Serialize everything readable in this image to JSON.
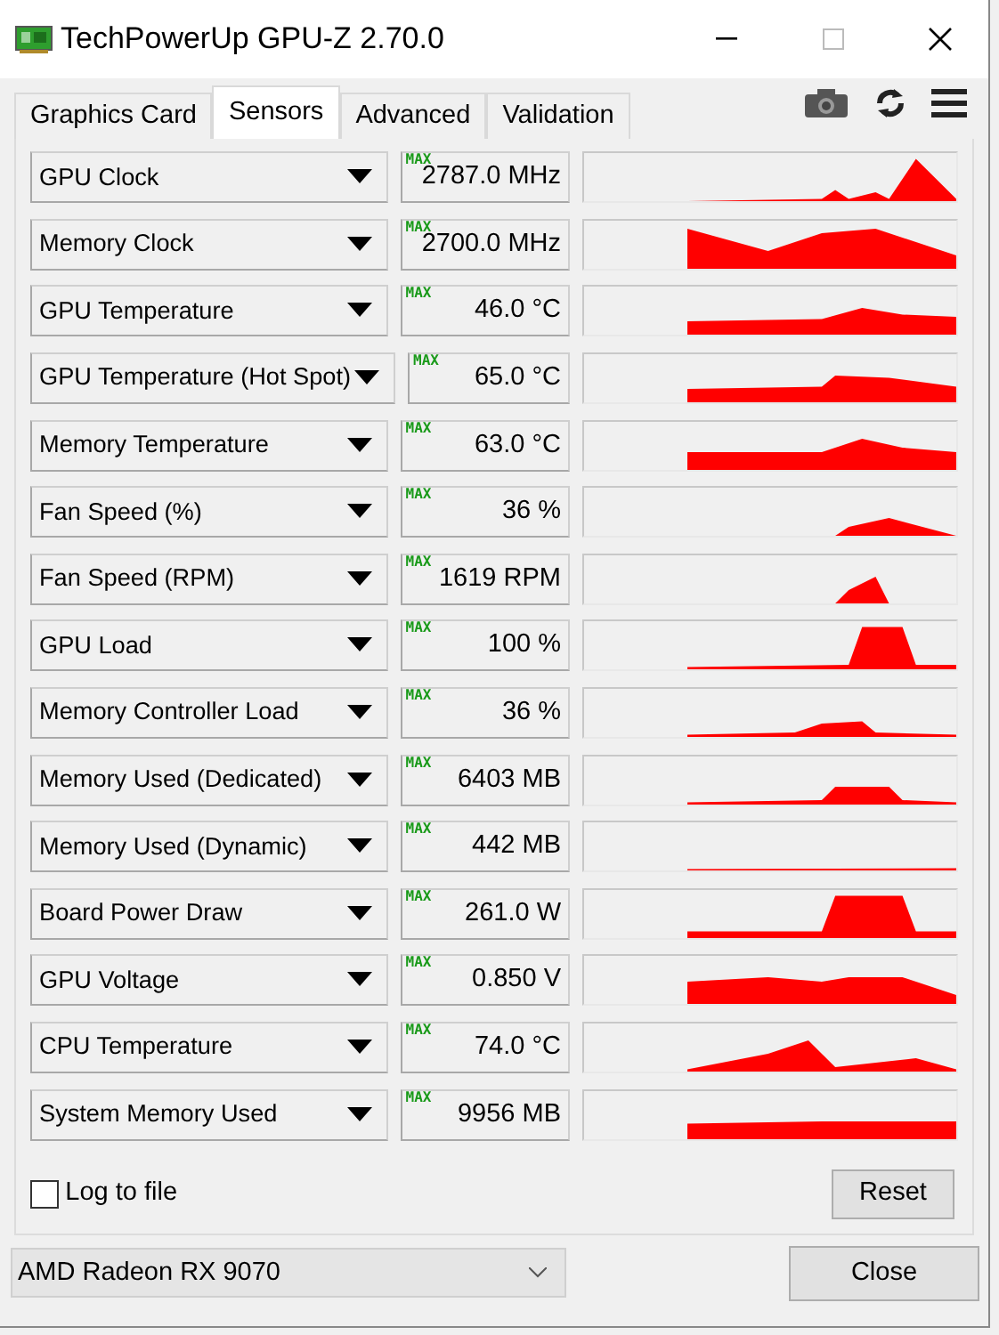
{
  "window": {
    "title": "TechPowerUp GPU-Z 2.70.0"
  },
  "tabs": [
    {
      "label": "Graphics Card",
      "selected": false
    },
    {
      "label": "Sensors",
      "selected": true
    },
    {
      "label": "Advanced",
      "selected": false
    },
    {
      "label": "Validation",
      "selected": false
    }
  ],
  "sensors": [
    {
      "name": "GPU Clock",
      "max_label": "MAX",
      "value": "2787.0 MHz"
    },
    {
      "name": "Memory Clock",
      "max_label": "MAX",
      "value": "2700.0 MHz"
    },
    {
      "name": "GPU Temperature",
      "max_label": "MAX",
      "value": "46.0 °C"
    },
    {
      "name": "GPU Temperature (Hot Spot)",
      "max_label": "MAX",
      "value": "65.0 °C"
    },
    {
      "name": "Memory Temperature",
      "max_label": "MAX",
      "value": "63.0 °C"
    },
    {
      "name": "Fan Speed (%)",
      "max_label": "MAX",
      "value": "36 %"
    },
    {
      "name": "Fan Speed (RPM)",
      "max_label": "MAX",
      "value": "1619 RPM"
    },
    {
      "name": "GPU Load",
      "max_label": "MAX",
      "value": "100 %"
    },
    {
      "name": "Memory Controller Load",
      "max_label": "MAX",
      "value": "36 %"
    },
    {
      "name": "Memory Used (Dedicated)",
      "max_label": "MAX",
      "value": "6403 MB"
    },
    {
      "name": "Memory Used (Dynamic)",
      "max_label": "MAX",
      "value": "442 MB"
    },
    {
      "name": "Board Power Draw",
      "max_label": "MAX",
      "value": "261.0 W"
    },
    {
      "name": "GPU Voltage",
      "max_label": "MAX",
      "value": "0.850 V"
    },
    {
      "name": "CPU Temperature",
      "max_label": "MAX",
      "value": "74.0 °C"
    },
    {
      "name": "System Memory Used",
      "max_label": "MAX",
      "value": "9956 MB"
    }
  ],
  "log_to_file": {
    "label": "Log to file",
    "checked": false
  },
  "reset_button": "Reset",
  "gpu_select": {
    "value": "AMD Radeon RX 9070"
  },
  "close_button": "Close"
}
